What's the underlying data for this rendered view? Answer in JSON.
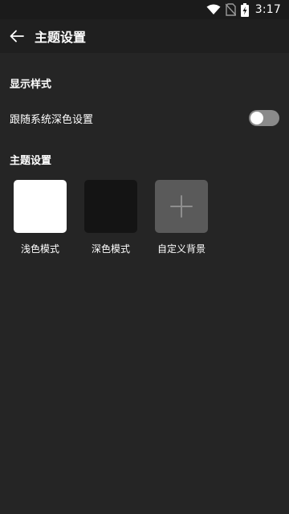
{
  "status_bar": {
    "time": "3:17",
    "icons": [
      "wifi-icon",
      "no-sim-icon",
      "battery-charging-icon"
    ]
  },
  "header": {
    "title": "主题设置",
    "back_icon": "arrow-left-icon"
  },
  "display_style": {
    "section_title": "显示样式",
    "follow_system_dark_label": "跟随系统深色设置",
    "follow_system_dark_enabled": false
  },
  "theme_settings": {
    "section_title": "主题设置",
    "options": [
      {
        "label": "浅色模式",
        "swatch_color": "#ffffff"
      },
      {
        "label": "深色模式",
        "swatch_color": "#141414"
      },
      {
        "label": "自定义背景",
        "swatch_color": "#5a5a5a",
        "icon": "plus-icon"
      }
    ]
  },
  "colors": {
    "background": "#252525",
    "app_bar": "#1f1f1f",
    "status_bar": "#1b1b1b",
    "toggle_off": "#8a8a8a"
  }
}
